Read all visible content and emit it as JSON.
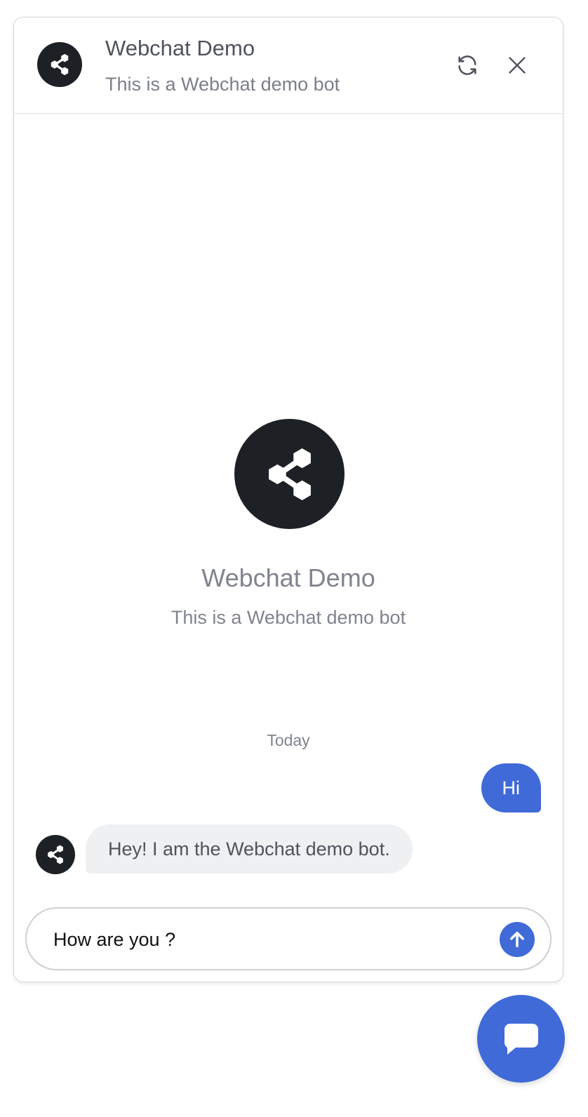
{
  "header": {
    "title": "Webchat Demo",
    "subtitle": "This is a Webchat demo bot",
    "avatar_icon": "share-nodes-icon",
    "restart_icon": "refresh-icon",
    "close_icon": "close-icon"
  },
  "intro": {
    "title": "Webchat Demo",
    "subtitle": "This is a Webchat demo bot"
  },
  "conversation": {
    "day_separator": "Today",
    "messages": [
      {
        "from": "user",
        "text": "Hi"
      },
      {
        "from": "bot",
        "text": "Hey! I am the Webchat demo bot."
      }
    ]
  },
  "composer": {
    "value": "How are you ?",
    "send_icon": "arrow-up-icon"
  },
  "launcher": {
    "icon": "chat-bubble-icon"
  },
  "colors": {
    "accent": "#3f6ad8",
    "avatar": "#1d2024",
    "bot_bubble": "#eff0f2",
    "muted_text": "#80848d"
  }
}
